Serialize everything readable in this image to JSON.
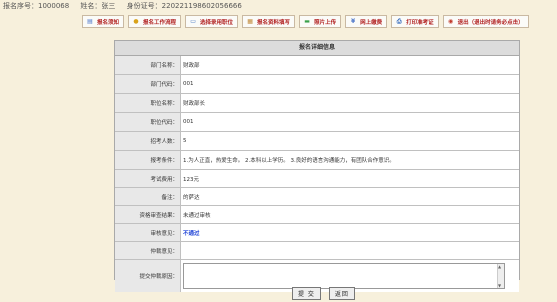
{
  "topinfo": {
    "reg_no": "报名序号：1000068",
    "name": "姓名：张三",
    "id_no": "身份证号：220221198602056666"
  },
  "toolbar": [
    {
      "label": "报名须知",
      "icon": "notice-icon",
      "color": "#4a74c8"
    },
    {
      "label": "报名工作流程",
      "icon": "workflow-icon",
      "color": "#d9a21a"
    },
    {
      "label": "选择录用职位",
      "icon": "position-icon",
      "color": "#3a6fbf"
    },
    {
      "label": "报名资料填写",
      "icon": "form-icon",
      "color": "#c08a3a"
    },
    {
      "label": "照片上传",
      "icon": "photo-icon",
      "color": "#3aa04a"
    },
    {
      "label": "网上缴费",
      "icon": "payment-icon",
      "color": "#4a74c8"
    },
    {
      "label": "打印准考证",
      "icon": "print-icon",
      "color": "#3a6fbf"
    },
    {
      "label": "退出（退出时请务必点击）",
      "icon": "exit-icon",
      "color": "#c0392b"
    }
  ],
  "panel": {
    "title": "报名详细信息",
    "fields": [
      {
        "label": "部门名称：",
        "value": "财政部"
      },
      {
        "label": "部门代码：",
        "value": "001"
      },
      {
        "label": "职位名称：",
        "value": "财政部长"
      },
      {
        "label": "职位代码：",
        "value": "001"
      },
      {
        "label": "招考人数：",
        "value": "5"
      },
      {
        "label": "报考条件：",
        "value": "1.为人正直，热爱生命。 2.本科以上学历。 3.良好的语言沟通能力，有团队合作意识。"
      },
      {
        "label": "考试费用：",
        "value": "123元"
      },
      {
        "label": "备注：",
        "value": "的萨达"
      },
      {
        "label": "资格审查结果：",
        "value": "未通过审核"
      },
      {
        "label": "审核意见：",
        "value": "不通过"
      },
      {
        "label": "仲裁意见：",
        "value": ""
      }
    ],
    "appeal_label": "提交仲裁原因：",
    "appeal_value": ""
  },
  "buttons": {
    "submit": "提 交",
    "back": "返回"
  }
}
